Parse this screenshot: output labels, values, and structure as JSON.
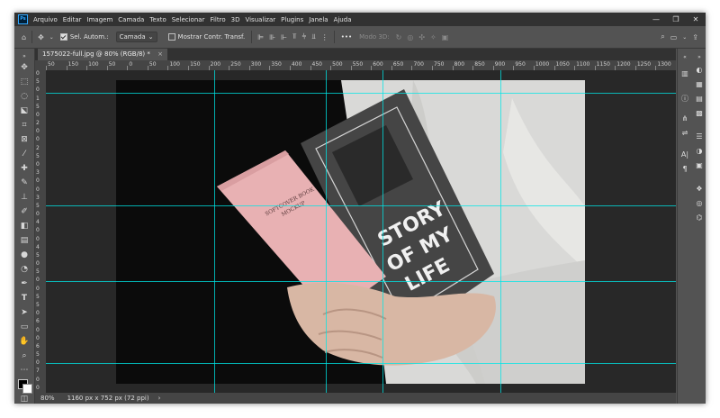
{
  "menu": {
    "logo": "Ps",
    "items": [
      "Arquivo",
      "Editar",
      "Imagem",
      "Camada",
      "Texto",
      "Selecionar",
      "Filtro",
      "3D",
      "Visualizar",
      "Plugins",
      "Janela",
      "Ajuda"
    ],
    "window_controls": [
      "—",
      "❐",
      "✕"
    ]
  },
  "options": {
    "auto_select_label": "Sel. Autom.:",
    "layer_dropdown": "Camada",
    "show_transform_label": "Mostrar Contr. Transf.",
    "more": "•••",
    "mode_3d": "Modo 3D:"
  },
  "document": {
    "tab_title": "1575022-full.jpg @ 80% (RGB/8) *",
    "close": "×"
  },
  "ruler": {
    "h_labels": [
      "50",
      "150",
      "100",
      "50",
      "0",
      "50",
      "100",
      "150",
      "200",
      "250",
      "300",
      "350",
      "400",
      "450",
      "500",
      "550",
      "600",
      "650",
      "700",
      "750",
      "800",
      "850",
      "900",
      "950",
      "1000",
      "1050",
      "1100",
      "1150",
      "1200",
      "1250",
      "1300"
    ],
    "v_labels": [
      "0",
      "5",
      "0",
      "1",
      "5",
      "0",
      "2",
      "0",
      "0",
      "2",
      "5",
      "0",
      "3",
      "0",
      "0",
      "3",
      "5",
      "0",
      "4",
      "0",
      "0",
      "4",
      "5",
      "0",
      "5",
      "0",
      "0",
      "5",
      "5",
      "0",
      "6",
      "0",
      "0",
      "6",
      "5",
      "0",
      "7",
      "0",
      "0"
    ]
  },
  "photo": {
    "book_title": "SOFTCOVER BOOK MOCKUP",
    "poster_line1": "STORY",
    "poster_line2": "OF MY",
    "poster_line3": "LIFE"
  },
  "status": {
    "zoom": "80%",
    "doc_size": "1160 px x 752 px (72 ppi)",
    "arrow": "›"
  },
  "colors": {
    "guide": "#00e6e6",
    "chrome_dark": "#323232",
    "chrome": "#535353",
    "book_pink": "#e8b1b3"
  }
}
